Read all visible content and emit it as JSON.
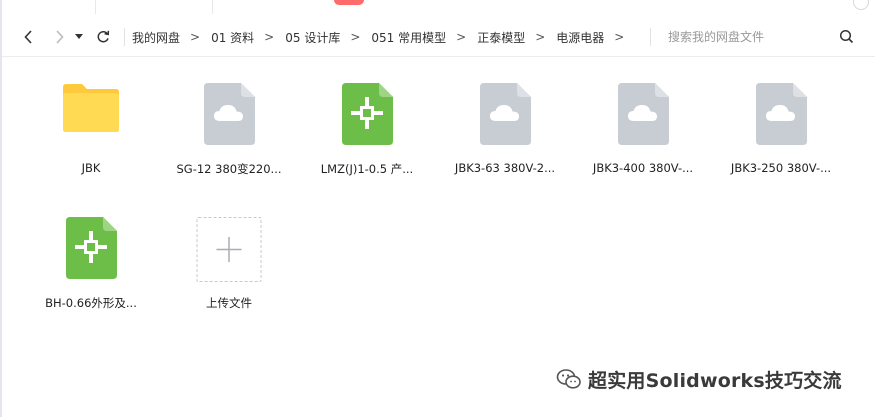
{
  "toolbar": {
    "back_icon": "chevron-left-icon",
    "forward_icon": "chevron-right-icon",
    "history_icon": "caret-down-icon",
    "refresh_icon": "refresh-icon"
  },
  "breadcrumb": [
    "我的网盘",
    "01 资料",
    "05 设计库",
    "051 常用模型",
    "正泰模型",
    "电源电器"
  ],
  "breadcrumb_separator": ">",
  "search": {
    "placeholder": "搜索我的网盘文件",
    "icon": "search-icon"
  },
  "files": [
    {
      "label": "JBK",
      "icon": "folder-icon",
      "kind": "folder"
    },
    {
      "label": "SG-12 380变220...",
      "icon": "cloud-file-icon",
      "kind": "cloud"
    },
    {
      "label": "LMZ(J)1-0.5 产...",
      "icon": "crosshair-file-icon",
      "kind": "model"
    },
    {
      "label": "JBK3-63 380V-2...",
      "icon": "cloud-file-icon",
      "kind": "cloud"
    },
    {
      "label": "JBK3-400 380V-...",
      "icon": "cloud-file-icon",
      "kind": "cloud"
    },
    {
      "label": "JBK3-250 380V-...",
      "icon": "cloud-file-icon",
      "kind": "cloud"
    },
    {
      "label": "BH-0.66外形及...",
      "icon": "crosshair-file-icon",
      "kind": "model"
    }
  ],
  "upload": {
    "label": "上传文件",
    "icon": "plus-icon"
  },
  "watermark": {
    "text": "超实用Solidworks技巧交流",
    "icon": "wechat-icon"
  },
  "colors": {
    "folder": "#FFD94A",
    "cloud_file": "#C9CDD4",
    "model_file": "#6DC04A",
    "text": "#222222"
  }
}
